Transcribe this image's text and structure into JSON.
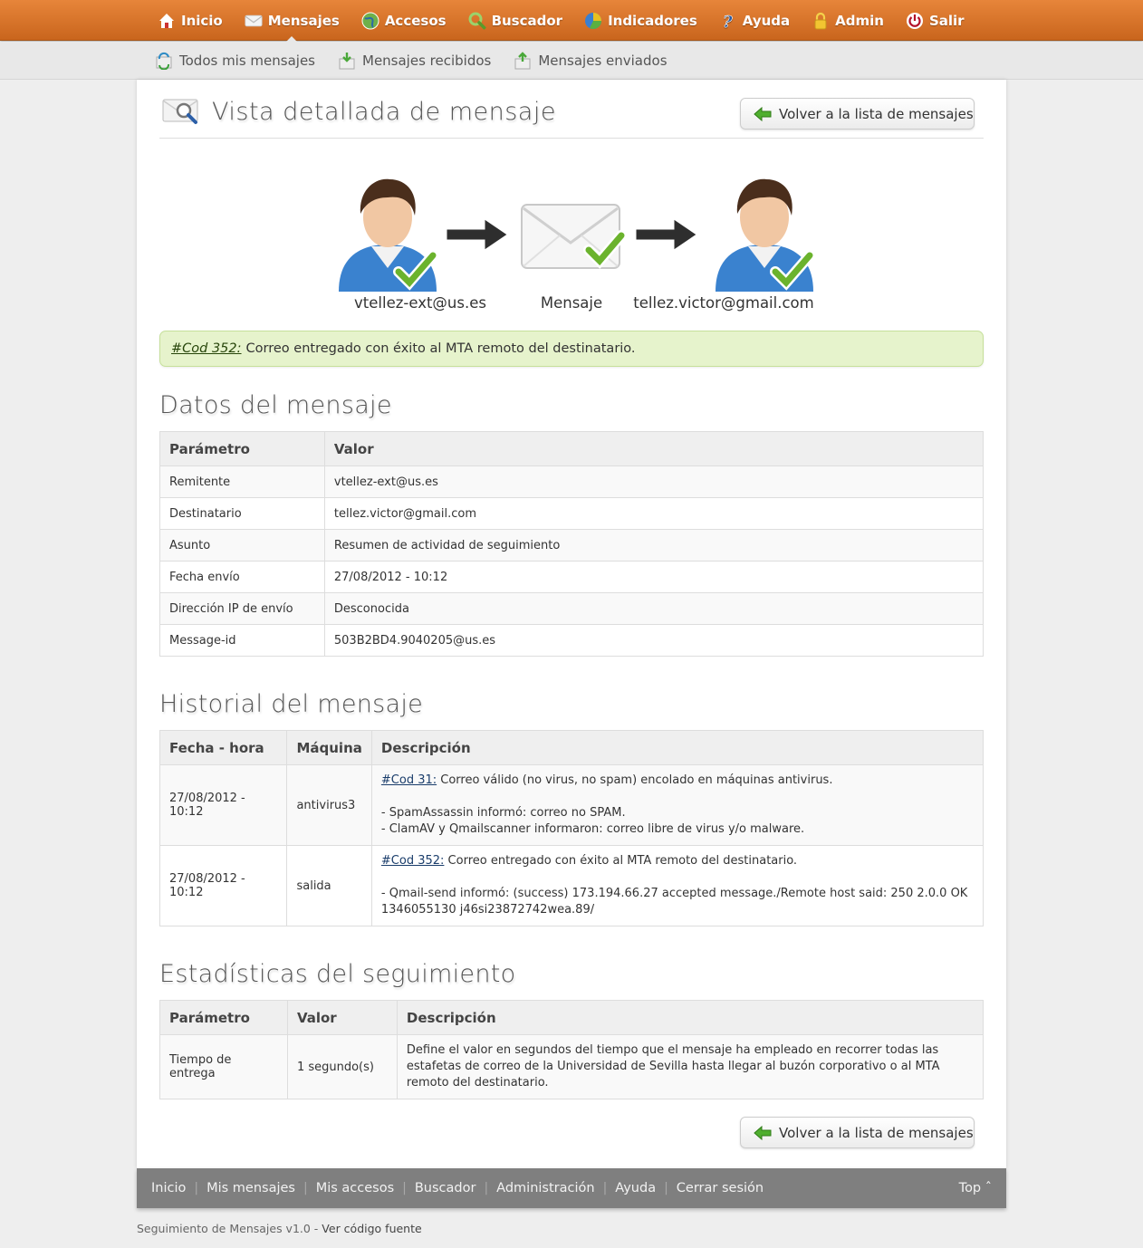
{
  "nav": {
    "items": [
      {
        "label": "Inicio",
        "icon": "home-icon"
      },
      {
        "label": "Mensajes",
        "icon": "envelope-icon",
        "active": true
      },
      {
        "label": "Accesos",
        "icon": "globe-icon"
      },
      {
        "label": "Buscador",
        "icon": "magnifier-icon"
      },
      {
        "label": "Indicadores",
        "icon": "pie-chart-icon"
      },
      {
        "label": "Ayuda",
        "icon": "help-icon"
      },
      {
        "label": "Admin",
        "icon": "lock-icon"
      },
      {
        "label": "Salir",
        "icon": "power-icon"
      }
    ]
  },
  "subnav": {
    "items": [
      {
        "label": "Todos mis mensajes",
        "icon": "refresh-mail-icon"
      },
      {
        "label": "Mensajes recibidos",
        "icon": "inbox-icon"
      },
      {
        "label": "Mensajes enviados",
        "icon": "outbox-icon"
      }
    ]
  },
  "page": {
    "title": "Vista detallada de mensaje",
    "back_label": "Volver a la lista de mensajes"
  },
  "flow": {
    "sender": "vtellez-ext@us.es",
    "message": "Mensaje",
    "recipient": "tellez.victor@gmail.com"
  },
  "alert": {
    "code": "#Cod 352:",
    "text": "Correo entregado con éxito al MTA remoto del destinatario."
  },
  "datos": {
    "heading": "Datos del mensaje",
    "columns": [
      "Parámetro",
      "Valor"
    ],
    "rows": [
      [
        "Remitente",
        "vtellez-ext@us.es"
      ],
      [
        "Destinatario",
        "tellez.victor@gmail.com"
      ],
      [
        "Asunto",
        "Resumen de actividad de seguimiento"
      ],
      [
        "Fecha envío",
        "27/08/2012 - 10:12"
      ],
      [
        "Dirección IP de envío",
        "Desconocida"
      ],
      [
        "Message-id",
        "503B2BD4.9040205@us.es"
      ]
    ]
  },
  "historial": {
    "heading": "Historial del mensaje",
    "columns": [
      "Fecha - hora",
      "Máquina",
      "Descripción"
    ],
    "rows": [
      {
        "date": "27/08/2012 - 10:12",
        "machine": "antivirus3",
        "code": "#Cod 31:",
        "summary": "Correo válido (no virus, no spam) encolado en máquinas antivirus.",
        "line1": "- SpamAssassin informó: correo no SPAM.",
        "line2": "- ClamAV y Qmailscanner informaron: correo libre de virus y/o malware."
      },
      {
        "date": "27/08/2012 - 10:12",
        "machine": "salida",
        "code": "#Cod 352:",
        "summary": "Correo entregado con éxito al MTA remoto del destinatario.",
        "line1": "- Qmail-send informó: (success) 173.194.66.27 accepted message./Remote host said: 250 2.0.0 OK 1346055130 j46si23872742wea.89/",
        "line2": ""
      }
    ]
  },
  "stats": {
    "heading": "Estadísticas del seguimiento",
    "columns": [
      "Parámetro",
      "Valor",
      "Descripción"
    ],
    "rows": [
      [
        "Tiempo de entrega",
        "1 segundo(s)",
        "Define el valor en segundos del tiempo que el mensaje ha empleado en recorrer todas las estafetas de correo de la Universidad de Sevilla hasta llegar al buzón corporativo o al MTA remoto del destinatario."
      ]
    ]
  },
  "footer": {
    "links": [
      "Inicio",
      "Mis mensajes",
      "Mis accesos",
      "Buscador",
      "Administración",
      "Ayuda",
      "Cerrar sesión"
    ],
    "top": "Top ˆ",
    "credits_text": "Seguimiento de Mensajes v1.0 - ",
    "credits_link": "Ver código fuente"
  },
  "colors": {
    "accent": "#d8712a",
    "success_bg": "#e6f3cc",
    "footer_bg": "#7f7f7f"
  }
}
